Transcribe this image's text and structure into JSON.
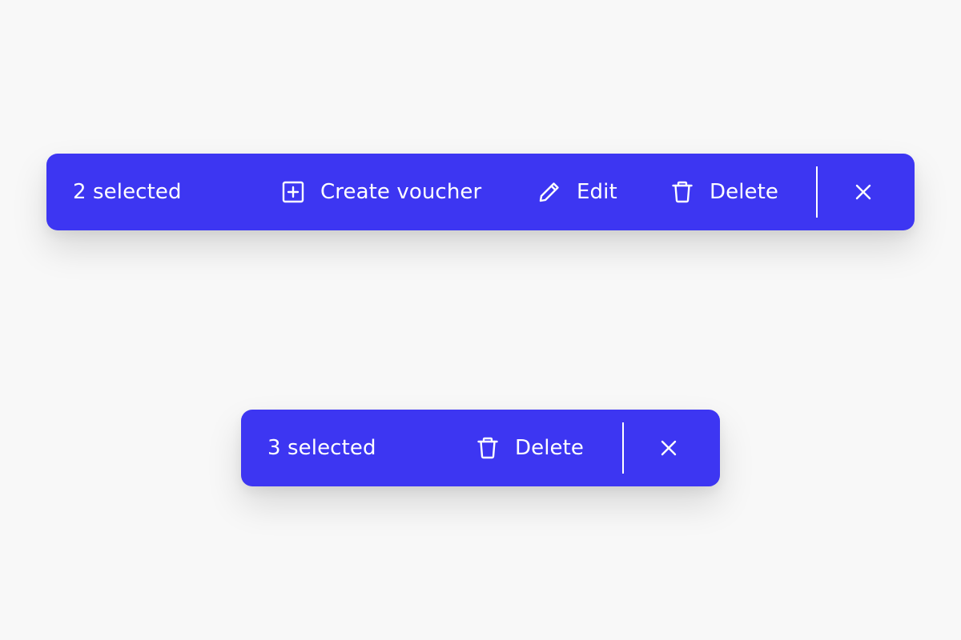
{
  "bars": [
    {
      "selection_text": "2 selected",
      "actions": [
        {
          "label": "Create voucher",
          "icon": "plus-square-icon"
        },
        {
          "label": "Edit",
          "icon": "pencil-icon"
        },
        {
          "label": "Delete",
          "icon": "trash-icon"
        }
      ],
      "close_icon": "close-icon"
    },
    {
      "selection_text": "3 selected",
      "actions": [
        {
          "label": "Delete",
          "icon": "trash-icon"
        }
      ],
      "close_icon": "close-icon"
    }
  ],
  "colors": {
    "background": "#f8f8f8",
    "bar": "#3d36f2",
    "foreground": "#ffffff"
  }
}
